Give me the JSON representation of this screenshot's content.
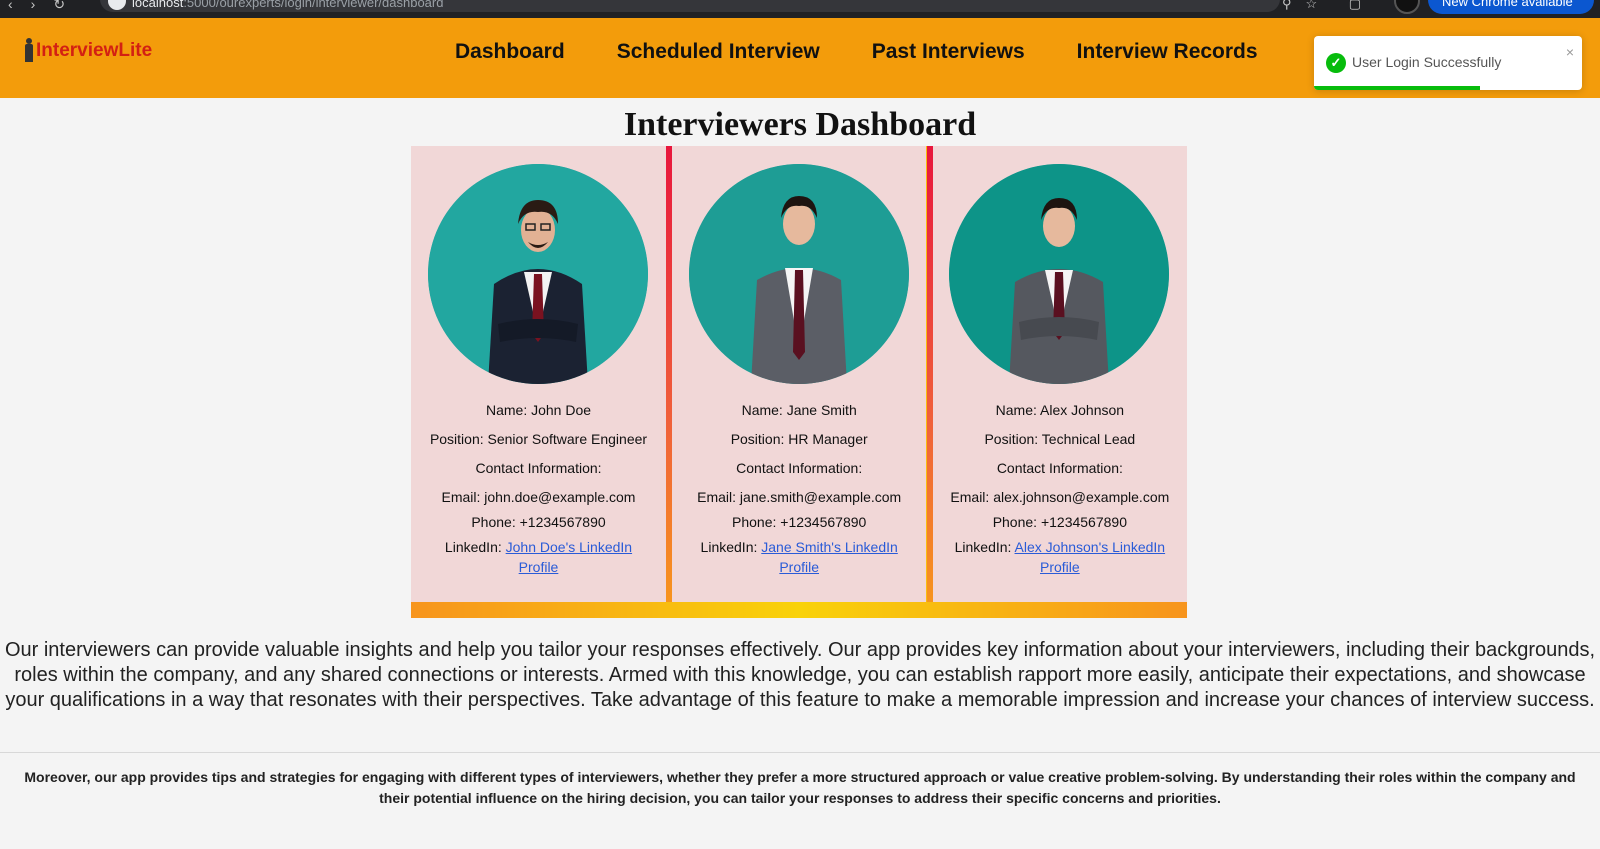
{
  "browser": {
    "url_host": "localhost",
    "url_path": ":5000/ourexperts/login/interviewer/dashboard",
    "update_button": "New Chrome available"
  },
  "header": {
    "logo_text": "InterviewLite",
    "nav": [
      "Dashboard",
      "Scheduled Interview",
      "Past Interviews",
      "Interview Records"
    ]
  },
  "toast": {
    "message": "User Login Successfully",
    "close": "×",
    "progress": 0.62
  },
  "page_title": "Interviewers Dashboard",
  "interviewers": [
    {
      "name": "Name: John Doe",
      "position": "Position: Senior Software Engineer",
      "contact_heading": "Contact Information:",
      "email": "Email: john.doe@example.com",
      "phone": "Phone: +1234567890",
      "linkedin_label": "LinkedIn: ",
      "linkedin_link": "John Doe's LinkedIn Profile"
    },
    {
      "name": "Name: Jane Smith",
      "position": "Position: HR Manager",
      "contact_heading": "Contact Information:",
      "email": "Email: jane.smith@example.com",
      "phone": "Phone: +1234567890",
      "linkedin_label": "LinkedIn: ",
      "linkedin_link": "Jane Smith's LinkedIn Profile"
    },
    {
      "name": "Name: Alex Johnson",
      "position": "Position: Technical Lead",
      "contact_heading": "Contact Information:",
      "email": "Email: alex.johnson@example.com",
      "phone": "Phone: +1234567890",
      "linkedin_label": "LinkedIn: ",
      "linkedin_link": "Alex Johnson's LinkedIn Profile"
    }
  ],
  "paragraph_1": "Our interviewers can provide valuable insights and help you tailor your responses effectively. Our app provides key information about your interviewers, including their backgrounds, roles within the company, and any shared connections or interests. Armed with this knowledge, you can establish rapport more easily, anticipate their expectations, and showcase your qualifications in a way that resonates with their perspectives. Take advantage of this feature to make a memorable impression and increase your chances of interview success.",
  "paragraph_2": "Moreover, our app provides tips and strategies for engaging with different types of interviewers, whether they prefer a more structured approach or value creative problem-solving. By understanding their roles within the company and their potential influence on the hiring decision, you can tailor your responses to address their specific concerns and priorities.",
  "colors": {
    "header_bg": "#f39c0b",
    "logo_text": "#d32013",
    "card_bg": "#f1d7d7",
    "avatar_bg": "#20a09a",
    "link": "#2a5bd7",
    "toast_success": "#07bc0c"
  }
}
